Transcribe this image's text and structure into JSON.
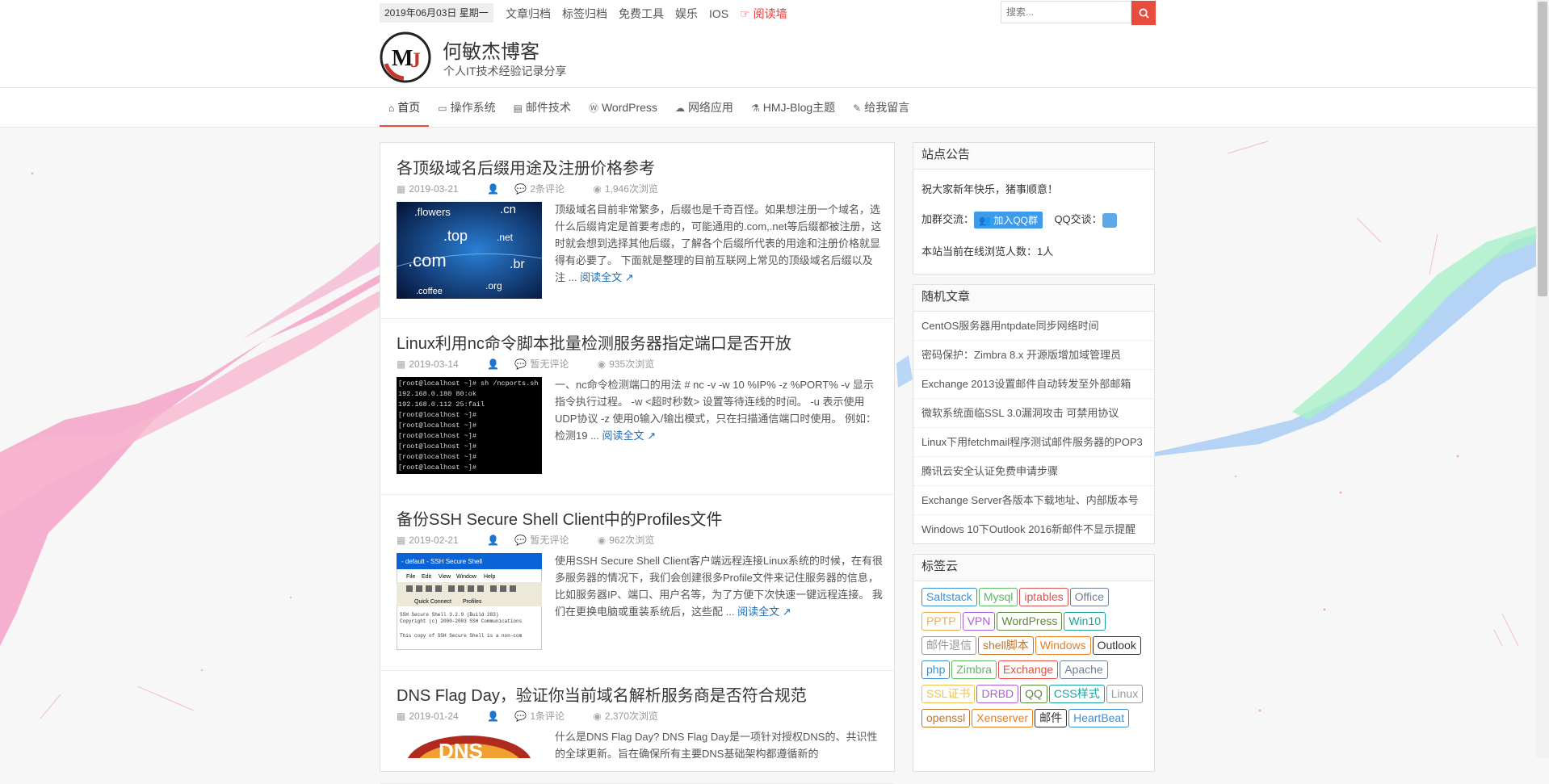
{
  "topbar": {
    "date": "2019年06月03日 星期一",
    "links": [
      "文章归档",
      "标签归档",
      "免费工具",
      "娱乐",
      "IOS"
    ],
    "hot_link": "阅读墙",
    "search_placeholder": "搜索..."
  },
  "header": {
    "title": "何敏杰博客",
    "subtitle": "个人IT技术经验记录分享",
    "logo_text": "MJ"
  },
  "nav": {
    "items": [
      "首页",
      "操作系统",
      "邮件技术",
      "WordPress",
      "网络应用",
      "HMJ-Blog主题",
      "给我留言"
    ]
  },
  "posts": [
    {
      "title": "各顶级域名后缀用途及注册价格参考",
      "date": "2019-03-21",
      "comments": "2条评论",
      "views": "1,946次浏览",
      "excerpt": "顶级域名目前非常繁多，后缀也是千奇百怪。如果想注册一个域名，选什么后缀肯定是首要考虑的，可能通用的.com,.net等后缀都被注册，这时就会想到选择其他后缀，了解各个后缀所代表的用途和注册价格就显得有必要了。 下面就是整理的目前互联网上常见的顶级域名后缀以及注 ...",
      "thumb_words": [
        ".flowers",
        ".cn",
        ".top",
        ".net",
        ".com",
        ".br",
        ".coffee",
        ".org"
      ]
    },
    {
      "title": "Linux利用nc命令脚本批量检测服务器指定端口是否开放",
      "date": "2019-03-14",
      "comments": "暂无评论",
      "views": "935次浏览",
      "excerpt": "一、nc命令检测端口的用法 # nc -v -w 10 %IP% -z %PORT% -v 显示指令执行过程。 -w <超时秒数> 设置等待连线的时间。 -u 表示使用UDP协议 -z 使用0输入/输出模式，只在扫描通信端口时使用。 例如：检测19 ...",
      "thumb_lines": [
        "[root@localhost ~]# sh /ncports.sh",
        "192.168.0.180 80:ok",
        "192.168.0.112 25:fail",
        "[root@localhost ~]#",
        "[root@localhost ~]#",
        "[root@localhost ~]#",
        "[root@localhost ~]#",
        "[root@localhost ~]#",
        "[root@localhost ~]#"
      ]
    },
    {
      "title": "备份SSH Secure Shell Client中的Profiles文件",
      "date": "2019-02-21",
      "comments": "暂无评论",
      "views": "962次浏览",
      "excerpt": "使用SSH Secure Shell Client客户端远程连接Linux系统的时候，在有很多服务器的情况下，我们会创建很多Profile文件来记住服务器的信息，比如服务器IP、端口、用户名等，为了方便下次快速一键远程连接。 我们在更换电脑或重装系统后，这些配 ...",
      "thumb_title": "- default - SSH Secure Shell",
      "thumb_menu": [
        "File",
        "Edit",
        "View",
        "Window",
        "Help"
      ],
      "thumb_buttons": [
        "Quick Connect",
        "Profiles"
      ],
      "thumb_lines": [
        "SSH Secure Shell 3.2.9 (Build 283)",
        "Copyright (c) 2000-2003 SSH Communications",
        "This copy of SSH Secure Shell is a non-com"
      ]
    },
    {
      "title": "DNS Flag Day，验证你当前域名解析服务商是否符合规范",
      "date": "2019-01-24",
      "comments": "1条评论",
      "views": "2,370次浏览",
      "excerpt": "什么是DNS Flag Day? DNS Flag Day是一项针对授权DNS的、共识性的全球更新。旨在确保所有主要DNS基础架构都遵循新的",
      "thumb_words": [
        "DNS"
      ]
    }
  ],
  "readmore": "阅读全文",
  "sidebar": {
    "notice": {
      "title": "站点公告",
      "line1": "祝大家新年快乐，猪事顺意！",
      "group_label": "加群交流：",
      "group_button": "加入QQ群",
      "qq_label": "QQ交谈：",
      "online": "本站当前在线浏览人数：1人"
    },
    "random": {
      "title": "随机文章",
      "items": [
        "CentOS服务器用ntpdate同步网络时间",
        "密码保护：Zimbra 8.x 开源版增加域管理员",
        "Exchange 2013设置邮件自动转发至外部邮箱",
        "微软系统面临SSL 3.0漏洞攻击 可禁用协议",
        "Linux下用fetchmail程序测试邮件服务器的POP3",
        "腾讯云安全认证免费申请步骤",
        "Exchange Server各版本下载地址、内部版本号",
        "Windows 10下Outlook 2016新邮件不显示提醒"
      ]
    },
    "tags": {
      "title": "标签云",
      "items": [
        {
          "label": "Saltstack",
          "color": "#3a8fd6"
        },
        {
          "label": "Mysql",
          "color": "#5cb85c"
        },
        {
          "label": "iptables",
          "color": "#d9534f"
        },
        {
          "label": "Office",
          "color": "#6f7f9a"
        },
        {
          "label": "PPTP",
          "color": "#f0ad4e"
        },
        {
          "label": "VPN",
          "color": "#b05cd6"
        },
        {
          "label": "WordPress",
          "color": "#5a8a3a"
        },
        {
          "label": "Win10",
          "color": "#1aa0a0"
        },
        {
          "label": "邮件退信",
          "color": "#999999"
        },
        {
          "label": "shell脚本",
          "color": "#c0762a"
        },
        {
          "label": "Windows",
          "color": "#e67e22"
        },
        {
          "label": "Outlook",
          "color": "#333333"
        },
        {
          "label": "php",
          "color": "#3a8fd6"
        },
        {
          "label": "Zimbra",
          "color": "#5cb85c"
        },
        {
          "label": "Exchange",
          "color": "#e74c3c"
        },
        {
          "label": "Apache",
          "color": "#6f7f9a"
        },
        {
          "label": "SSL证书",
          "color": "#f0c24e"
        },
        {
          "label": "DRBD",
          "color": "#b05cd6"
        },
        {
          "label": "QQ",
          "color": "#5a8a3a"
        },
        {
          "label": "CSS样式",
          "color": "#1aa0a0"
        },
        {
          "label": "Linux",
          "color": "#999999"
        },
        {
          "label": "openssl",
          "color": "#c0762a"
        },
        {
          "label": "Xenserver",
          "color": "#e67e22"
        },
        {
          "label": "邮件",
          "color": "#333333"
        },
        {
          "label": "HeartBeat",
          "color": "#3a8fd6"
        }
      ]
    }
  },
  "colors": {
    "accent": "#e74c3c",
    "link": "#1e6bb8"
  }
}
